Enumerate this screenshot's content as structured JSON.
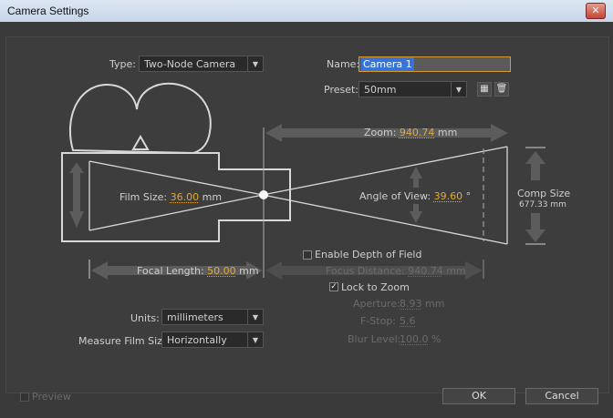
{
  "window": {
    "title": "Camera Settings",
    "close_glyph": "✕"
  },
  "type": {
    "label": "Type:",
    "value": "Two-Node Camera"
  },
  "name": {
    "label": "Name:",
    "value": "Camera 1"
  },
  "preset": {
    "label": "Preset:",
    "value": "50mm"
  },
  "zoom": {
    "label": "Zoom:",
    "value": "940.74",
    "unit": "mm"
  },
  "film_size": {
    "label": "Film Size:",
    "value": "36.00",
    "unit": "mm"
  },
  "angle_of_view": {
    "label": "Angle of View:",
    "value": "39.60",
    "unit": "°"
  },
  "comp_size": {
    "label": "Comp Size",
    "value": "677.33 mm"
  },
  "depth_of_field": {
    "label": "Enable Depth of Field",
    "checked": false
  },
  "focal_length": {
    "label": "Focal Length:",
    "value": "50.00",
    "unit": "mm"
  },
  "focus_distance": {
    "label": "Focus Distance:",
    "value": "940.74",
    "unit": "mm"
  },
  "lock_to_zoom": {
    "label": "Lock to Zoom",
    "checked": true,
    "check_glyph": "✓"
  },
  "aperture": {
    "label": "Aperture:",
    "value": "8.93",
    "unit": "mm"
  },
  "fstop": {
    "label": "F-Stop:",
    "value": "5.6"
  },
  "blur_level": {
    "label": "Blur Level:",
    "value": "100.0",
    "unit": "%"
  },
  "units": {
    "label": "Units:",
    "value": "millimeters"
  },
  "measure_film_size": {
    "label": "Measure Film Size:",
    "value": "Horizontally"
  },
  "preview": {
    "label": "Preview"
  },
  "buttons": {
    "ok": "OK",
    "cancel": "Cancel"
  }
}
